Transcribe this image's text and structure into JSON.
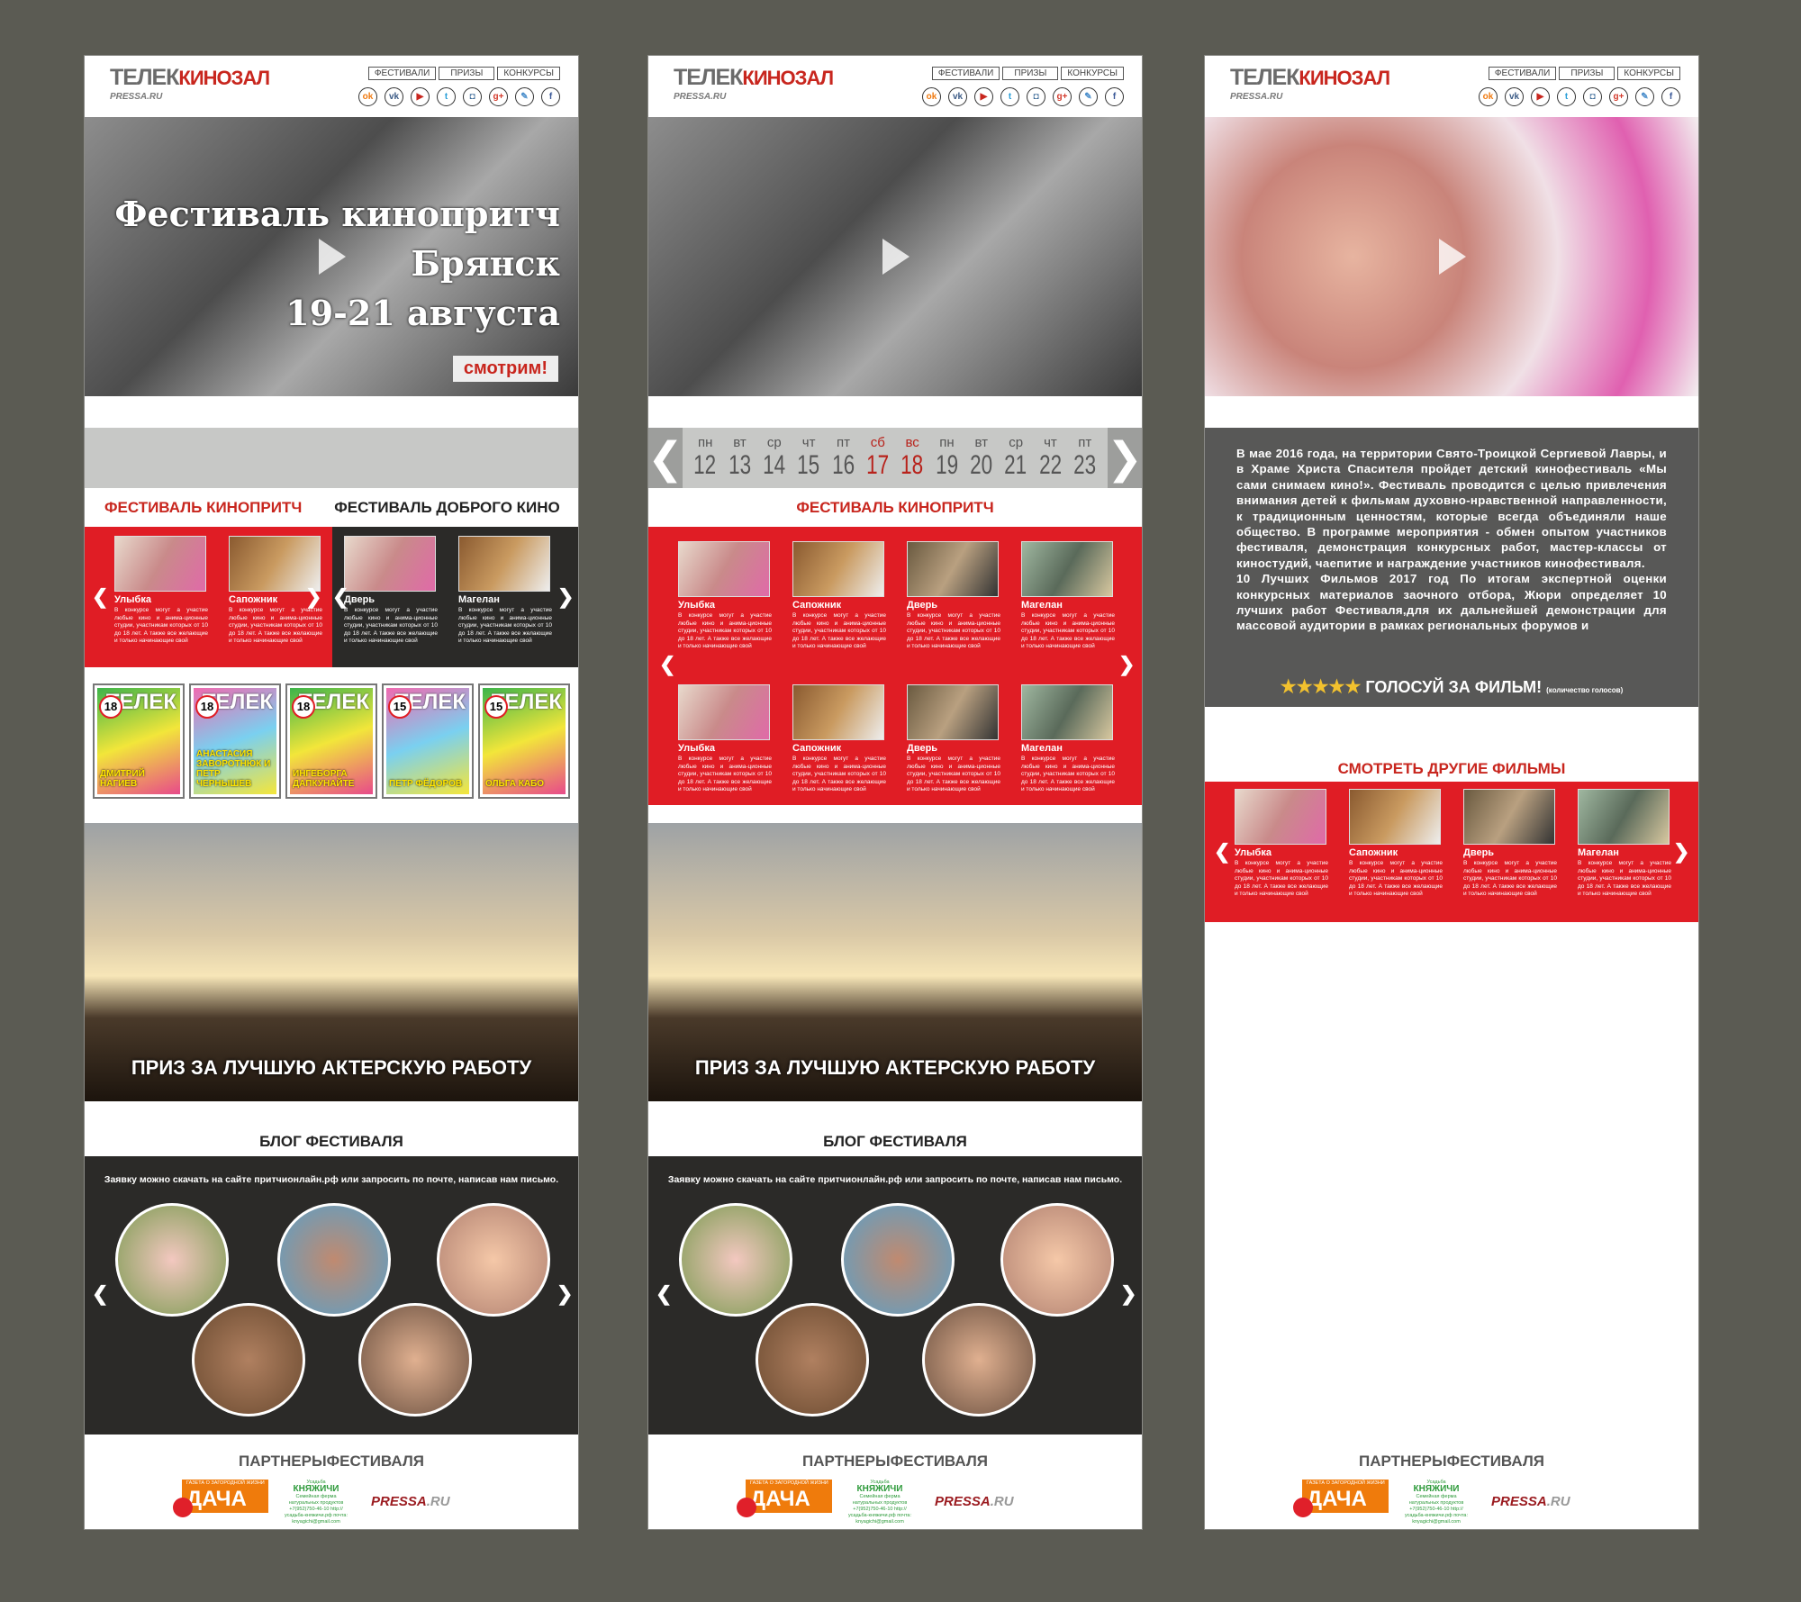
{
  "header": {
    "logo_a": "ТЕЛЕК",
    "logo_b": "КИНОЗАЛ",
    "pressa": "PRESSA.RU",
    "nav": [
      "ФЕСТИВАЛИ",
      "ПРИЗЫ",
      "КОНКУРСЫ"
    ],
    "social": [
      {
        "icon": "odnoklassniki-icon",
        "g": "ok",
        "c": "#f07a10"
      },
      {
        "icon": "vk-icon",
        "g": "vk",
        "c": "#3b5a85"
      },
      {
        "icon": "youtube-icon",
        "g": "▶",
        "c": "#c8261e"
      },
      {
        "icon": "twitter-icon",
        "g": "t",
        "c": "#2a9fd8"
      },
      {
        "icon": "instagram-icon",
        "g": "◘",
        "c": "#3f6d9a"
      },
      {
        "icon": "google-plus-icon",
        "g": "g+",
        "c": "#d33a2c"
      },
      {
        "icon": "livejournal-icon",
        "g": "✎",
        "c": "#4a8ecb"
      },
      {
        "icon": "facebook-icon",
        "g": "f",
        "c": "#3b5998"
      }
    ]
  },
  "hero": {
    "line1": "Фестиваль кинопритч",
    "line2": "Брянск",
    "line3": "19-21 августа",
    "watch": "смотрим!"
  },
  "calendar": [
    {
      "w": "пн",
      "n": "12"
    },
    {
      "w": "вт",
      "n": "13"
    },
    {
      "w": "ср",
      "n": "14"
    },
    {
      "w": "чт",
      "n": "15"
    },
    {
      "w": "пт",
      "n": "16"
    },
    {
      "w": "сб",
      "n": "17",
      "we": true
    },
    {
      "w": "вс",
      "n": "18",
      "we": true
    },
    {
      "w": "пн",
      "n": "19"
    },
    {
      "w": "вт",
      "n": "20"
    },
    {
      "w": "ср",
      "n": "21"
    },
    {
      "w": "чт",
      "n": "22"
    },
    {
      "w": "пт",
      "n": "23"
    }
  ],
  "festivals": {
    "pritch": "ФЕСТИВАЛЬ КИНОПРИТЧ",
    "dobro": "ФЕСТИВАЛЬ ДОБРОГО КИНО"
  },
  "card_text": "В конкурсе могут а участие любые кино и анима-ционные студии, участникам которых от 10 до 18 лет. А также все желающие и только начинающие свой",
  "films": [
    "Улыбка",
    "Сапожник",
    "Дверь",
    "Магелан"
  ],
  "magazines": [
    {
      "brand": "ТЕЛЕК",
      "price": "18",
      "who": "ДМИТРИЙ НАГИЕВ"
    },
    {
      "brand": "ТЕЛЕК",
      "price": "18",
      "who": "АНАСТАСИЯ ЗАВОРОТНЮК И ПЕТР ЧЕРНЫШЕВ"
    },
    {
      "brand": "ТЕЛЕК",
      "price": "18",
      "who": "ИНГЕБОРГА ДАПКУНАЙТЕ"
    },
    {
      "brand": "ТЕЛЕК",
      "price": "15",
      "who": "ПЕТР ФЁДОРОВ"
    },
    {
      "brand": "ТЕЛЕК",
      "price": "15",
      "who": "ОЛЬГА КАБО"
    }
  ],
  "prize": "ПРИЗ ЗА ЛУЧШУЮ АКТЕРСКУЮ РАБОТУ",
  "blog": {
    "title": "БЛОГ ФЕСТИВАЛЯ",
    "msg": "Заявку можно скачать на сайте притчионлайн.рф или запросить по почте, написав нам письмо."
  },
  "partners": {
    "title": "ПАРТНЕРЫФЕСТИВАЛЯ",
    "dacha_top": "ГАЗЕТА О ЗАГОРОДНОЙ ЖИЗНИ",
    "dacha": "ДАЧА",
    "usadba": "Усадьба",
    "knyazhichi": "КНЯЖИЧИ",
    "kn_lines": "Семейная ферма натуральных продуктов +7(952)750-46-10 http://усадьба-княжичи.рф почта: knyagichi@gmail.com",
    "pressa_a": "PRESSA",
    "pressa_b": ".RU"
  },
  "about": {
    "p1": "В мае 2016 года, на территории Свято-Троицкой Сергиевой Лавры, и в Храме Христа Спасителя пройдет детский кинофестиваль «Мы сами снимаем кино!». Фестиваль проводится с целью привлечения внимания детей к фильмам духовно-нравственной направленности, к традиционным ценностям, которые всегда объединяли наше общество. В программе мероприятия - обмен опытом участников фестиваля, демонстрация конкурсных работ, мастер-классы от киностудий, чаепитие и награждение участников кинофестиваля.",
    "p2": "10 Лучших Фильмов 2017 год По итогам экспертной оценки конкурсных материалов заочного отбора, Жюри определяет 10 лучших работ Фестиваля,для их дальнейшей демонстрации для массовой аудитории в рамках региональных форумов и",
    "stars": "★★★★★",
    "vote": "ГОЛОСУЙ ЗА ФИЛЬМ!",
    "votes_note": "(количество голосов)"
  },
  "other_films": "СМОТРЕТЬ ДРУГИЕ ФИЛЬМЫ",
  "colors": {
    "red": "#e01d25",
    "dark": "#2b2a28",
    "bg": "#5b5b53"
  }
}
